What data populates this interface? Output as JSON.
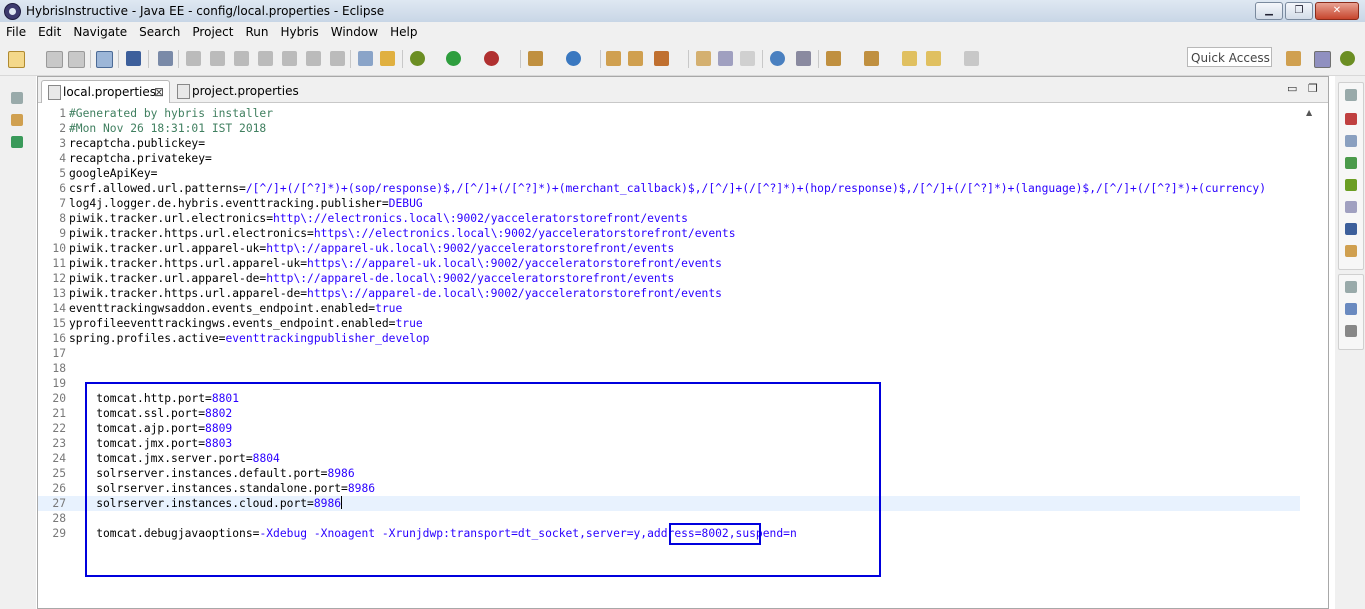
{
  "window": {
    "title": "HybrisInstructive - Java EE - config/local.properties - Eclipse",
    "minimize": "▁",
    "restore": "❐",
    "close": "✕"
  },
  "menu": [
    "File",
    "Edit",
    "Navigate",
    "Search",
    "Project",
    "Run",
    "Hybris",
    "Window",
    "Help"
  ],
  "toolbar": {
    "quick_access": "Quick Access"
  },
  "tabs": [
    {
      "label": "local.properties",
      "close": "⊠"
    },
    {
      "label": "project.properties"
    }
  ],
  "editor_controls": {
    "minimize": "▭",
    "maximize": "❐"
  },
  "lines": [
    {
      "n": "1",
      "text": "#Generated by hybris installer"
    },
    {
      "n": "2",
      "text": "#Mon Nov 26 18:31:01 IST 2018"
    },
    {
      "n": "3",
      "text": "recaptcha.publickey="
    },
    {
      "n": "4",
      "text": "recaptcha.privatekey="
    },
    {
      "n": "5",
      "text": "googleApiKey="
    },
    {
      "n": "6",
      "key": "csrf.allowed.url.patterns=",
      "value": "/[^/]+(/[^?]*)+(sop/response)$,/[^/]+(/[^?]*)+(merchant_callback)$,/[^/]+(/[^?]*)+(hop/response)$,/[^/]+(/[^?]*)+(language)$,/[^/]+(/[^?]*)+(currency)"
    },
    {
      "n": "7",
      "key": "log4j.logger.de.hybris.eventtracking.publisher=",
      "value": "DEBUG"
    },
    {
      "n": "8",
      "key": "piwik.tracker.url.electronics=",
      "value": "http\\://electronics.local\\:9002/yacceleratorstorefront/events"
    },
    {
      "n": "9",
      "key": "piwik.tracker.https.url.electronics=",
      "value": "https\\://electronics.local\\:9002/yacceleratorstorefront/events"
    },
    {
      "n": "10",
      "key": "piwik.tracker.url.apparel-uk=",
      "value": "http\\://apparel-uk.local\\:9002/yacceleratorstorefront/events"
    },
    {
      "n": "11",
      "key": "piwik.tracker.https.url.apparel-uk=",
      "value": "https\\://apparel-uk.local\\:9002/yacceleratorstorefront/events"
    },
    {
      "n": "12",
      "key": "piwik.tracker.url.apparel-de=",
      "value": "http\\://apparel-de.local\\:9002/yacceleratorstorefront/events"
    },
    {
      "n": "13",
      "key": "piwik.tracker.https.url.apparel-de=",
      "value": "https\\://apparel-de.local\\:9002/yacceleratorstorefront/events"
    },
    {
      "n": "14",
      "key": "eventtrackingwsaddon.events_endpoint.enabled=",
      "value": "true"
    },
    {
      "n": "15",
      "key": "yprofileeventtrackingws.events_endpoint.enabled=",
      "value": "true"
    },
    {
      "n": "16",
      "key": "spring.profiles.active=",
      "value": "eventtrackingpublisher_develop"
    },
    {
      "n": "17",
      "text": ""
    },
    {
      "n": "18",
      "text": ""
    },
    {
      "n": "19",
      "text": ""
    },
    {
      "n": "20",
      "key": "    tomcat.http.port=",
      "value": "8801"
    },
    {
      "n": "21",
      "key": "    tomcat.ssl.port=",
      "value": "8802"
    },
    {
      "n": "22",
      "key": "    tomcat.ajp.port=",
      "value": "8809"
    },
    {
      "n": "23",
      "key": "    tomcat.jmx.port=",
      "value": "8803"
    },
    {
      "n": "24",
      "key": "    tomcat.jmx.server.port=",
      "value": "8804"
    },
    {
      "n": "25",
      "key": "    solrserver.instances.default.port=",
      "value": "8986"
    },
    {
      "n": "26",
      "key": "    solrserver.instances.standalone.port=",
      "value": "8986"
    },
    {
      "n": "27",
      "key": "    solrserver.instances.cloud.port=",
      "value": "8986"
    },
    {
      "n": "28",
      "text": ""
    },
    {
      "n": "29",
      "key": "    tomcat.debugjavaoptions=",
      "value": "-Xdebug -Xnoagent -Xrunjdwp:transport=dt_socket,server=y,address=8002,suspend=n"
    }
  ],
  "colors": {
    "value": "#2a00ff",
    "highlight_box": "#0000dd",
    "current_line": "#e8f2fe"
  }
}
